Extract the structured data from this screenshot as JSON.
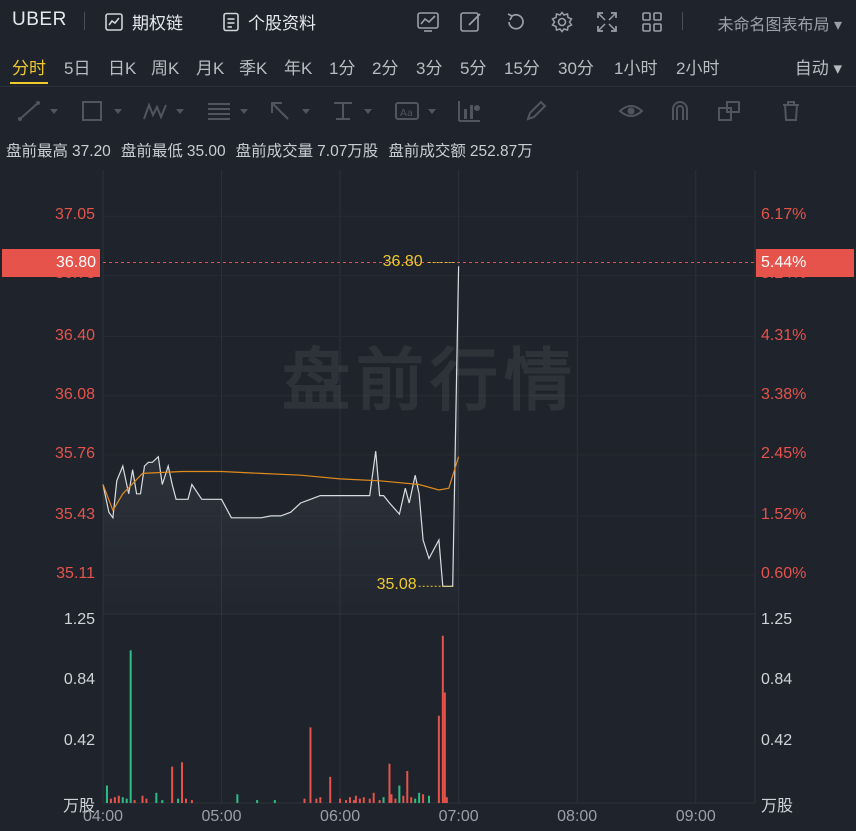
{
  "header": {
    "ticker": "UBER",
    "options_chain": "期权链",
    "stock_profile": "个股资料",
    "layout_name": "未命名图表布局"
  },
  "periods": [
    "分时",
    "5日",
    "日K",
    "周K",
    "月K",
    "季K",
    "年K",
    "1分",
    "2分",
    "3分",
    "5分",
    "15分",
    "30分",
    "1小时",
    "2小时"
  ],
  "active_period": "分时",
  "auto_label": "自动",
  "premarket": {
    "high_label": "盘前最高",
    "high": "37.20",
    "low_label": "盘前最低",
    "low": "35.00",
    "volume_label": "盘前成交量",
    "volume": "7.07万股",
    "amount_label": "盘前成交额",
    "amount": "252.87万"
  },
  "watermark": "盘前行情",
  "chart_data": {
    "type": "line",
    "title": "",
    "x_ticks": [
      "04:00",
      "05:00",
      "06:00",
      "07:00",
      "08:00",
      "09:00"
    ],
    "x_range": [
      "04:00",
      "09:30"
    ],
    "price_axis_left": [
      "37.05",
      "36.73",
      "36.40",
      "36.08",
      "35.76",
      "35.43",
      "35.11"
    ],
    "price_axis_right": [
      "6.17%",
      "5.24%",
      "4.31%",
      "3.38%",
      "2.45%",
      "1.52%",
      "0.60%"
    ],
    "price_range": [
      34.9,
      37.3
    ],
    "volume_axis": [
      "1.25",
      "0.84",
      "0.42"
    ],
    "volume_unit": "万股",
    "volume_range": [
      0,
      1.3
    ],
    "current_price": "36.80",
    "current_pct": "5.44%",
    "high_marker": "36.80",
    "low_marker": "35.08",
    "colors": {
      "up": "#e5534b",
      "down": "#2ebd85",
      "price": "#d9dde2",
      "avg": "#e08a1e",
      "marker": "#f0c92d"
    },
    "series": [
      {
        "name": "price",
        "x": [
          "04:00",
          "04:03",
          "04:05",
          "04:07",
          "04:10",
          "04:13",
          "04:15",
          "04:17",
          "04:19",
          "04:21",
          "04:23",
          "04:25",
          "04:28",
          "04:30",
          "04:33",
          "04:35",
          "04:37",
          "04:40",
          "04:43",
          "04:45",
          "04:50",
          "04:55",
          "05:00",
          "05:05",
          "05:10",
          "05:15",
          "05:20",
          "05:25",
          "05:30",
          "05:35",
          "05:40",
          "05:45",
          "05:50",
          "05:55",
          "06:00",
          "06:05",
          "06:10",
          "06:15",
          "06:18",
          "06:20",
          "06:22",
          "06:25",
          "06:30",
          "06:33",
          "06:35",
          "06:38",
          "06:40",
          "06:42",
          "06:45",
          "06:50",
          "06:52",
          "06:55",
          "06:57",
          "07:00"
        ],
        "y": [
          35.6,
          35.45,
          35.42,
          35.62,
          35.7,
          35.55,
          35.68,
          35.55,
          35.55,
          35.7,
          35.72,
          35.72,
          35.75,
          35.6,
          35.7,
          35.6,
          35.52,
          35.52,
          35.52,
          35.6,
          35.52,
          35.52,
          35.52,
          35.42,
          35.42,
          35.42,
          35.42,
          35.43,
          35.43,
          35.45,
          35.5,
          35.52,
          35.54,
          35.54,
          35.54,
          35.54,
          35.54,
          35.54,
          35.78,
          35.54,
          35.54,
          35.5,
          35.44,
          35.58,
          35.5,
          35.65,
          35.55,
          35.3,
          35.2,
          35.3,
          35.05,
          35.05,
          35.05,
          36.78
        ]
      },
      {
        "name": "avg",
        "x": [
          "04:00",
          "04:05",
          "04:10",
          "04:20",
          "04:40",
          "05:00",
          "05:20",
          "05:40",
          "06:00",
          "06:20",
          "06:40",
          "06:50",
          "06:55",
          "07:00"
        ],
        "y": [
          35.6,
          35.46,
          35.55,
          35.66,
          35.67,
          35.67,
          35.66,
          35.65,
          35.63,
          35.62,
          35.6,
          35.57,
          35.58,
          35.75
        ]
      }
    ],
    "volume": {
      "x": [
        "04:02",
        "04:04",
        "04:06",
        "04:08",
        "04:10",
        "04:12",
        "04:14",
        "04:16",
        "04:20",
        "04:22",
        "04:27",
        "04:30",
        "04:35",
        "04:38",
        "04:40",
        "04:42",
        "04:45",
        "05:08",
        "05:18",
        "05:27",
        "05:42",
        "05:45",
        "05:48",
        "05:50",
        "05:55",
        "06:00",
        "06:03",
        "06:05",
        "06:07",
        "06:08",
        "06:10",
        "06:12",
        "06:15",
        "06:17",
        "06:20",
        "06:22",
        "06:25",
        "06:26",
        "06:28",
        "06:30",
        "06:32",
        "06:34",
        "06:36",
        "06:38",
        "06:40",
        "06:42",
        "06:45",
        "06:50",
        "06:52",
        "06:53",
        "06:54"
      ],
      "v": [
        0.12,
        0.03,
        0.04,
        0.05,
        0.04,
        0.03,
        1.05,
        0.02,
        0.05,
        0.03,
        0.07,
        0.02,
        0.25,
        0.03,
        0.28,
        0.03,
        0.02,
        0.06,
        0.02,
        0.02,
        0.03,
        0.52,
        0.03,
        0.04,
        0.18,
        0.03,
        0.02,
        0.04,
        0.02,
        0.05,
        0.03,
        0.04,
        0.03,
        0.07,
        0.02,
        0.04,
        0.27,
        0.06,
        0.03,
        0.12,
        0.05,
        0.22,
        0.04,
        0.03,
        0.07,
        0.06,
        0.05,
        0.6,
        1.15,
        0.76,
        0.04
      ],
      "dir": [
        "d",
        "u",
        "u",
        "u",
        "d",
        "d",
        "d",
        "u",
        "u",
        "u",
        "d",
        "d",
        "u",
        "d",
        "u",
        "u",
        "u",
        "d",
        "d",
        "d",
        "u",
        "u",
        "u",
        "u",
        "u",
        "u",
        "u",
        "u",
        "u",
        "u",
        "u",
        "u",
        "u",
        "u",
        "u",
        "d",
        "u",
        "u",
        "u",
        "d",
        "u",
        "u",
        "u",
        "d",
        "d",
        "u",
        "d",
        "u",
        "u",
        "u",
        "u"
      ]
    }
  }
}
